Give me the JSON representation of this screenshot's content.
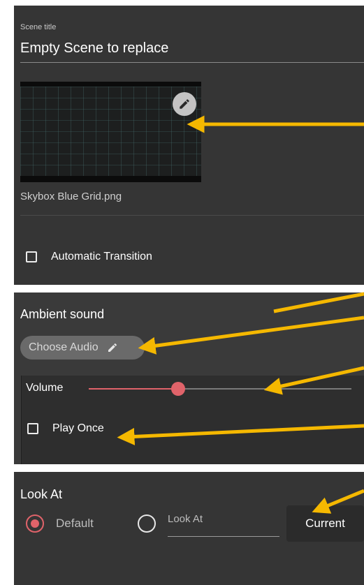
{
  "scene": {
    "title_label": "Scene title",
    "title_value": "Empty Scene to replace",
    "skybox_filename": "Skybox Blue Grid.png",
    "edit_icon": "pencil-icon",
    "automatic_transition_label": "Automatic Transition",
    "automatic_transition_checked": false
  },
  "ambient": {
    "section_title": "Ambient sound",
    "choose_audio_label": "Choose Audio",
    "choose_audio_icon": "pencil-icon",
    "volume_label": "Volume",
    "volume_fraction": 0.34,
    "play_once_label": "Play Once",
    "play_once_checked": false
  },
  "look_at": {
    "section_title": "Look At",
    "options": [
      {
        "label": "Default",
        "selected": true
      },
      {
        "label": "Look At",
        "selected": false
      }
    ],
    "current_button_label": "Current"
  },
  "colors": {
    "panel_bg": "#353535",
    "accent": "#e0636a",
    "annotation_arrow": "#f5b800"
  }
}
